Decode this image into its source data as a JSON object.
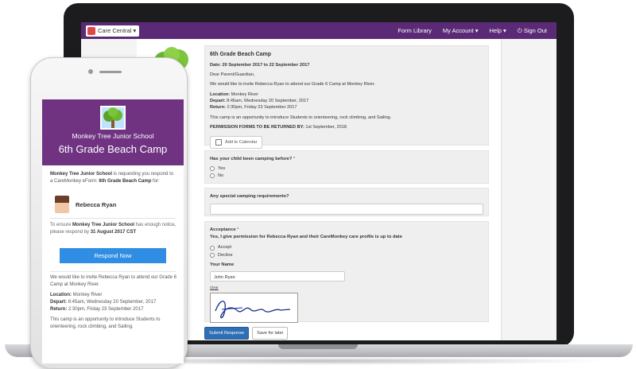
{
  "laptop": {
    "nav": {
      "brand": "Care Central",
      "brand_caret": "▾",
      "links": [
        "Form Library",
        "My Account ▾",
        "Help ▾",
        "⏻ Sign Out"
      ]
    },
    "form": {
      "title": "6th Grade Beach Camp",
      "date_line": "Date: 20 September 2017 to 22 September 2017",
      "greeting": "Dear Parent/Guardian,",
      "invite": "We would like to invite Rebecca Ryan to attend our Grade 6 Camp at Monkey River.",
      "location_label": "Location:",
      "location_value": " Monkey River",
      "depart_label": "Depart:",
      "depart_value": " 8:45am, Wednesday 20 September, 2017",
      "return_label": "Return:",
      "return_value": " 2:30pm, Friday 23 September 2017",
      "description": "This camp is an opportunity to introduce Students to orienteering, rock climbing, and Sailing.",
      "permission_label": "PERMISSION FORMS TO BE RETURNED BY:",
      "permission_value": " 1st September, 2018",
      "calendar_button": "Add to Calendar"
    },
    "q1": {
      "label": "Has your child been camping before?",
      "required": "*",
      "options": [
        "Yes",
        "No"
      ]
    },
    "q2": {
      "label": "Any special camping requirements?"
    },
    "acceptance": {
      "label": "Acceptance",
      "required": "*",
      "statement": "Yes, I give permission for Rebecca Ryan and their CareMonkey care profile is up to date",
      "options": [
        "Accept",
        "Decline"
      ],
      "name_label": "Your Name",
      "name_value": "John Ryan",
      "clear_label": "Clear"
    },
    "buttons": {
      "submit": "Submit Response",
      "save": "Save for later"
    }
  },
  "phone": {
    "school": "Monkey Tree Junior School",
    "title": "6th Grade Beach Camp",
    "request_school": "Monkey Tree Junior School",
    "request_text": " is requesting you respond to a CareMonkey eForm: ",
    "request_form": "6th Grade Beach Camp",
    "request_tail": " for:",
    "person": "Rebecca Ryan",
    "ensure_pre": "To ensure ",
    "ensure_school": "Monkey Tree Junior School",
    "ensure_mid": " has enough notice, please respond by ",
    "ensure_date": "31 August 2017 CST",
    "respond_button": "Respond Now",
    "invite": "We would like to invite Rebecca Ryan to attend our Grade 6 Camp at Monkey River.",
    "location_label": "Location:",
    "location_value": " Monkey River",
    "depart_label": "Depart:",
    "depart_value": " 8:45am, Wednesday 20 September, 2017",
    "return_label": "Return:",
    "return_value": " 2:30pm, Friday 23 September 2017",
    "description": "This camp is an opportunity to introduce Students to orienteering, rock climbing, and Sailing."
  },
  "colors": {
    "brand_purple": "#5b2a76",
    "phone_header": "#6f3382",
    "respond_blue": "#2f8de4",
    "submit_blue": "#2f6fb5"
  }
}
